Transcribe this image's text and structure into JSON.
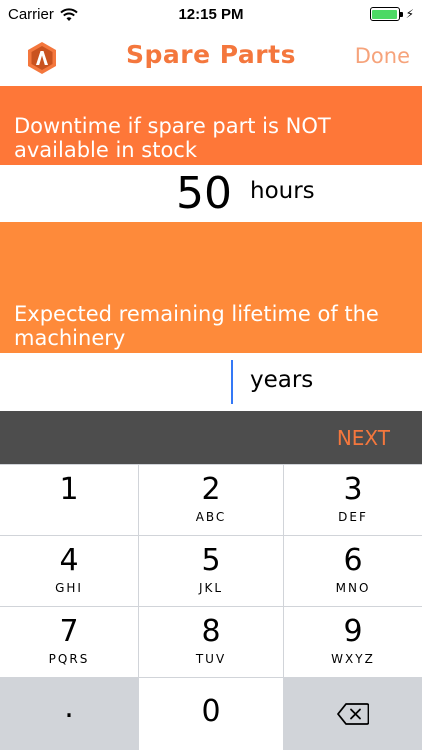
{
  "status_bar": {
    "carrier": "Carrier",
    "time": "12:15 PM",
    "battery_level": 1.0,
    "battery_color": "#4cd964"
  },
  "nav": {
    "title": "Spare Parts",
    "done_label": "Done",
    "logo_icon": "app-logo-icon"
  },
  "downtime": {
    "label": "Downtime if spare part is NOT available in stock",
    "value": "50",
    "unit": "hours"
  },
  "lifetime": {
    "label": "Expected remaining lifetime of the machinery",
    "value": "",
    "unit": "years"
  },
  "accessory": {
    "next_label": "NEXT"
  },
  "keypad": {
    "keys": [
      {
        "digit": "1",
        "letters": ""
      },
      {
        "digit": "2",
        "letters": "ABC"
      },
      {
        "digit": "3",
        "letters": "DEF"
      },
      {
        "digit": "4",
        "letters": "GHI"
      },
      {
        "digit": "5",
        "letters": "JKL"
      },
      {
        "digit": "6",
        "letters": "MNO"
      },
      {
        "digit": "7",
        "letters": "PQRS"
      },
      {
        "digit": "8",
        "letters": "TUV"
      },
      {
        "digit": "9",
        "letters": "WXYZ"
      }
    ],
    "dot": ".",
    "zero": "0",
    "backspace_icon": "backspace-icon"
  },
  "colors": {
    "accent": "#f4773d",
    "downtime_bg": "#fe7738",
    "lifetime_bg": "#fe8a3a",
    "accessory_bg": "#4d4d4d",
    "cursor": "#3478f6"
  }
}
